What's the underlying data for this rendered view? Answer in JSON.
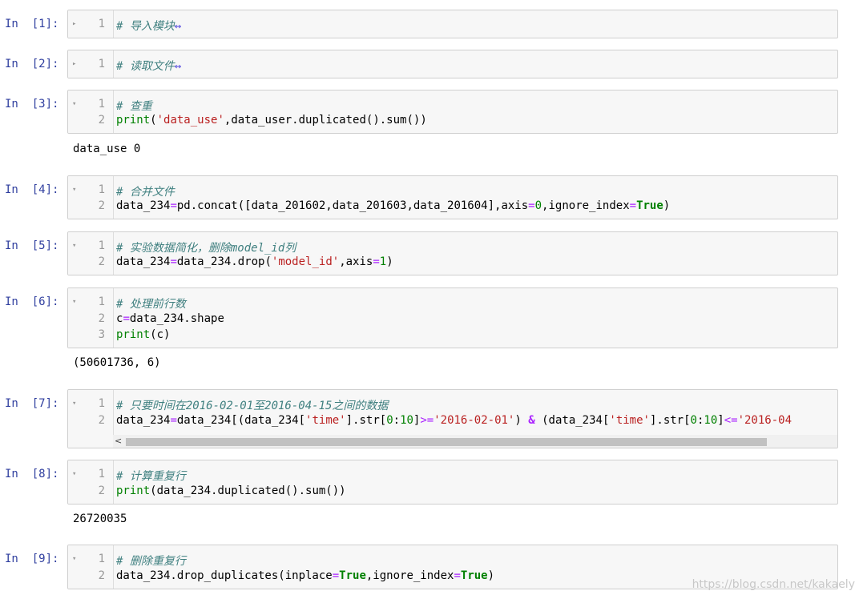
{
  "colors": {
    "prompt": "#303f9f",
    "comment": "#408080",
    "string": "#ba2121",
    "builtin": "#008000",
    "operator": "#aa22ff",
    "cell_bg": "#f7f7f7",
    "cell_border": "#cfcfcf"
  },
  "icons": {
    "collapsed": "triangle-right-icon",
    "expanded": "triangle-down-icon",
    "folded_marker": "double-arrow-icon"
  },
  "cells": [
    {
      "prompt": "In  [1]:",
      "lines": [
        {
          "num": "1",
          "comment": "# 导入模块",
          "marker": "↔"
        }
      ]
    },
    {
      "prompt": "In  [2]:",
      "lines": [
        {
          "num": "1",
          "comment": "# 读取文件",
          "marker": "↔"
        }
      ]
    },
    {
      "prompt": "In  [3]:",
      "lines": [
        {
          "num": "1",
          "comment": "# 查重"
        },
        {
          "num": "2",
          "code": "print('data_use',data_user.duplicated().sum())"
        }
      ],
      "output": "data_use 0"
    },
    {
      "prompt": "In  [4]:",
      "lines": [
        {
          "num": "1",
          "comment": "# 合并文件"
        },
        {
          "num": "2",
          "code": "data_234=pd.concat([data_201602,data_201603,data_201604],axis=0,ignore_index=True)"
        }
      ]
    },
    {
      "prompt": "In  [5]:",
      "lines": [
        {
          "num": "1",
          "comment": "# 实验数据简化，删除model_id列"
        },
        {
          "num": "2",
          "code": "data_234=data_234.drop('model_id',axis=1)"
        }
      ]
    },
    {
      "prompt": "In  [6]:",
      "lines": [
        {
          "num": "1",
          "comment": "# 处理前行数"
        },
        {
          "num": "2",
          "code": "c=data_234.shape"
        },
        {
          "num": "3",
          "code": "print(c)"
        }
      ],
      "output": "(50601736, 6)"
    },
    {
      "prompt": "In  [7]:",
      "lines": [
        {
          "num": "1",
          "comment": "# 只要时间在2016-02-01至2016-04-15之间的数据"
        },
        {
          "num": "2",
          "code": "data_234=data_234[(data_234['time'].str[0:10]>='2016-02-01') & (data_234['time'].str[0:10]<='2016-04"
        }
      ],
      "scroll_left": "<"
    },
    {
      "prompt": "In  [8]:",
      "lines": [
        {
          "num": "1",
          "comment": "# 计算重复行"
        },
        {
          "num": "2",
          "code": "print(data_234.duplicated().sum())"
        }
      ],
      "output": "26720035"
    },
    {
      "prompt": "In  [9]:",
      "lines": [
        {
          "num": "1",
          "comment": "# 删除重复行"
        },
        {
          "num": "2",
          "code": "data_234.drop_duplicates(inplace=True,ignore_index=True)"
        }
      ]
    }
  ],
  "watermark": "https://blog.csdn.net/kakaely"
}
